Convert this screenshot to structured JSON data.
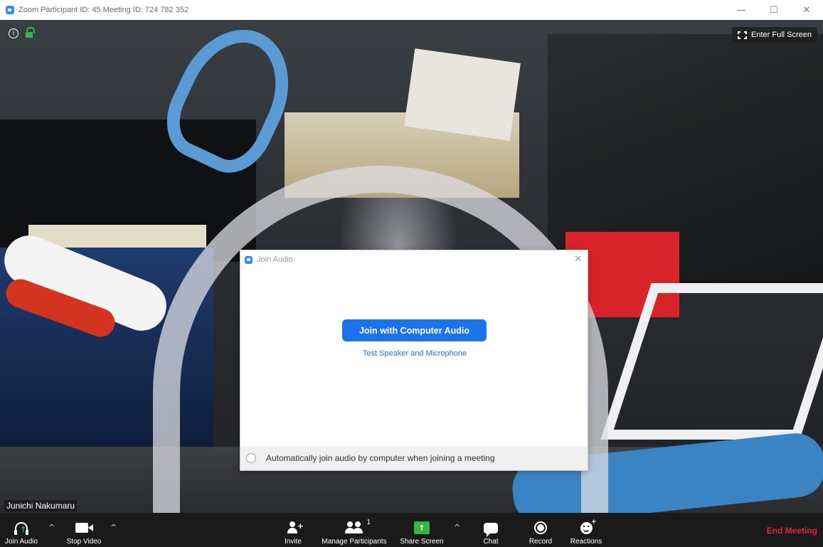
{
  "window": {
    "title": "Zoom Participant ID: 45   Meeting ID: 724 782 352",
    "minimize": "—",
    "maximize": "☐",
    "close": "✕"
  },
  "video": {
    "info_icon": "i",
    "full_screen_label": "Enter Full Screen",
    "participant_name": "Junichi Nakumaru"
  },
  "dialog": {
    "title": "Join Audio",
    "close": "✕",
    "join_button": "Join with Computer Audio",
    "test_link": "Test Speaker and Microphone",
    "auto_join_label": "Automatically join audio by computer when joining a meeting"
  },
  "toolbar": {
    "join_audio": "Join Audio",
    "stop_video": "Stop Video",
    "invite": "Invite",
    "manage_participants": "Manage Participants",
    "participant_count": "1",
    "share_screen": "Share Screen",
    "chat": "Chat",
    "record": "Record",
    "reactions": "Reactions",
    "end_meeting": "End Meeting",
    "caret": "^",
    "arrow_up": "↑",
    "plus": "+"
  },
  "colors": {
    "zoom_blue": "#2d8cff",
    "button_blue": "#1a73e8",
    "share_green": "#37b24d",
    "end_red": "#e02828",
    "toolbar_bg": "#1a1a1a"
  }
}
